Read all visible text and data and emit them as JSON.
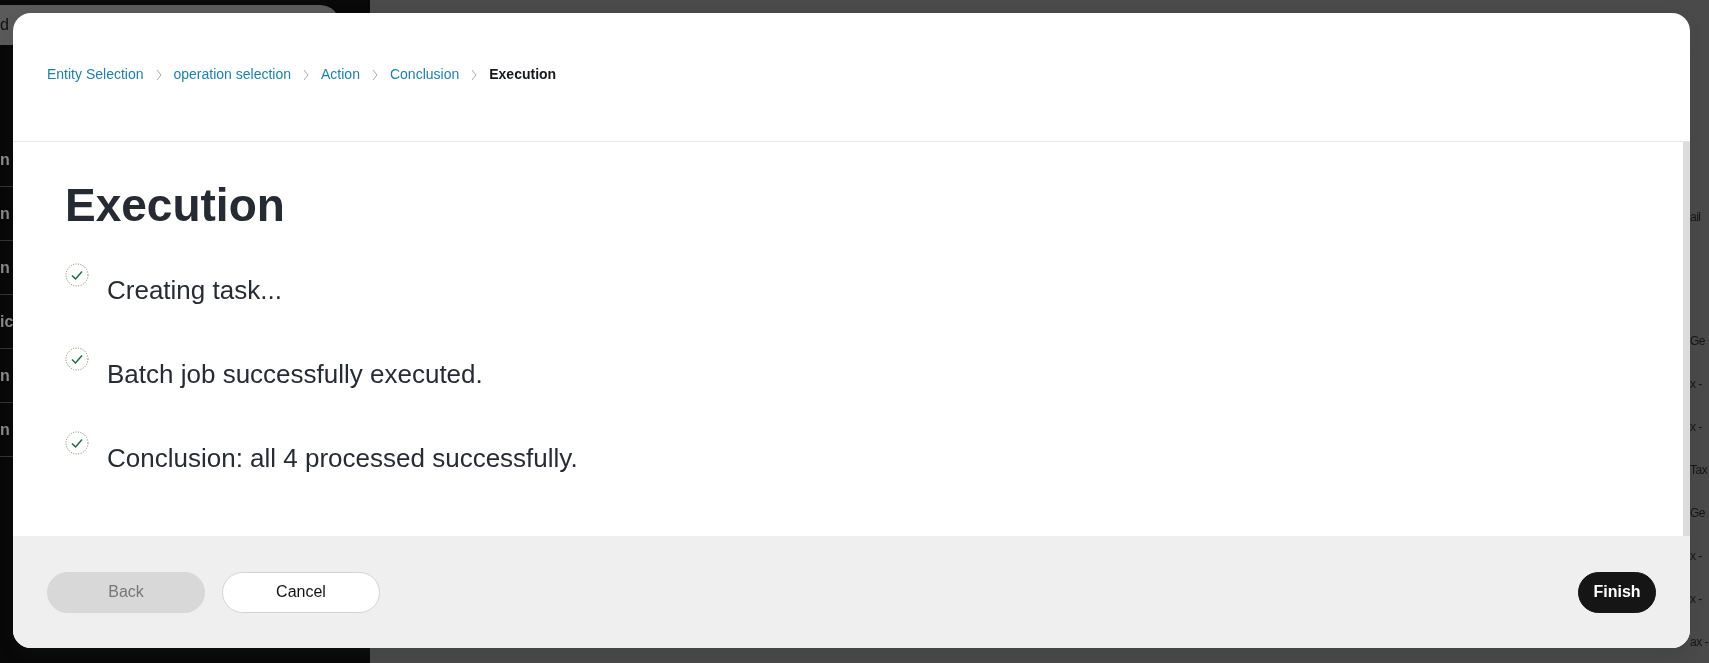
{
  "background": {
    "search_fragment": "d",
    "left_rows": [
      "n",
      "n",
      "n",
      "ic",
      "n",
      "n"
    ],
    "right_rows": [
      "ail",
      "Ge",
      "x -",
      "x -",
      "Tax",
      "Ge",
      "x -",
      "x -",
      "ax -"
    ]
  },
  "dialog": {
    "breadcrumb": [
      {
        "label": "Entity Selection",
        "selected": false
      },
      {
        "label": "operation selection",
        "selected": false
      },
      {
        "label": "Action",
        "selected": false
      },
      {
        "label": "Conclusion",
        "selected": false
      },
      {
        "label": "Execution",
        "selected": true
      }
    ],
    "title": "Execution",
    "steps": [
      {
        "text": "Creating task...",
        "done": true
      },
      {
        "text": "Batch job successfully executed.",
        "done": true
      },
      {
        "text": "Conclusion: all 4 processed successfully.",
        "done": true
      }
    ],
    "buttons": [
      {
        "label": "Back",
        "kind": "secondary",
        "disabled": true
      },
      {
        "label": "Cancel",
        "kind": "secondary",
        "disabled": false
      },
      {
        "label": "Finish",
        "kind": "primary",
        "disabled": false
      }
    ]
  }
}
